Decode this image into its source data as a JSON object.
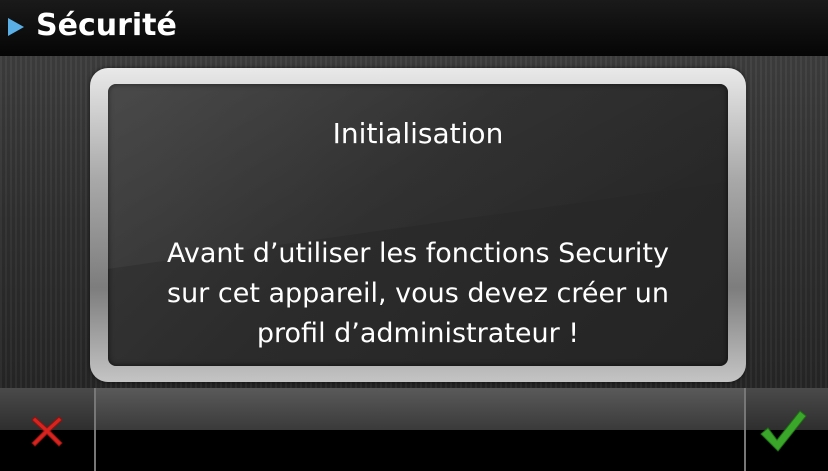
{
  "header": {
    "title": "Sécurité",
    "arrow_icon": "play-triangle-icon",
    "accent_color": "#5ab0e6"
  },
  "dialog": {
    "title": "Initialisation",
    "message_lines": [
      "Avant d’utiliser les fonctions Security",
      "sur cet appareil, vous devez créer un",
      "profil d’administrateur !"
    ]
  },
  "footer": {
    "cancel_icon": "red-x-icon",
    "cancel_color": "#d9231e",
    "confirm_icon": "green-check-icon",
    "confirm_color": "#3aa62a"
  }
}
